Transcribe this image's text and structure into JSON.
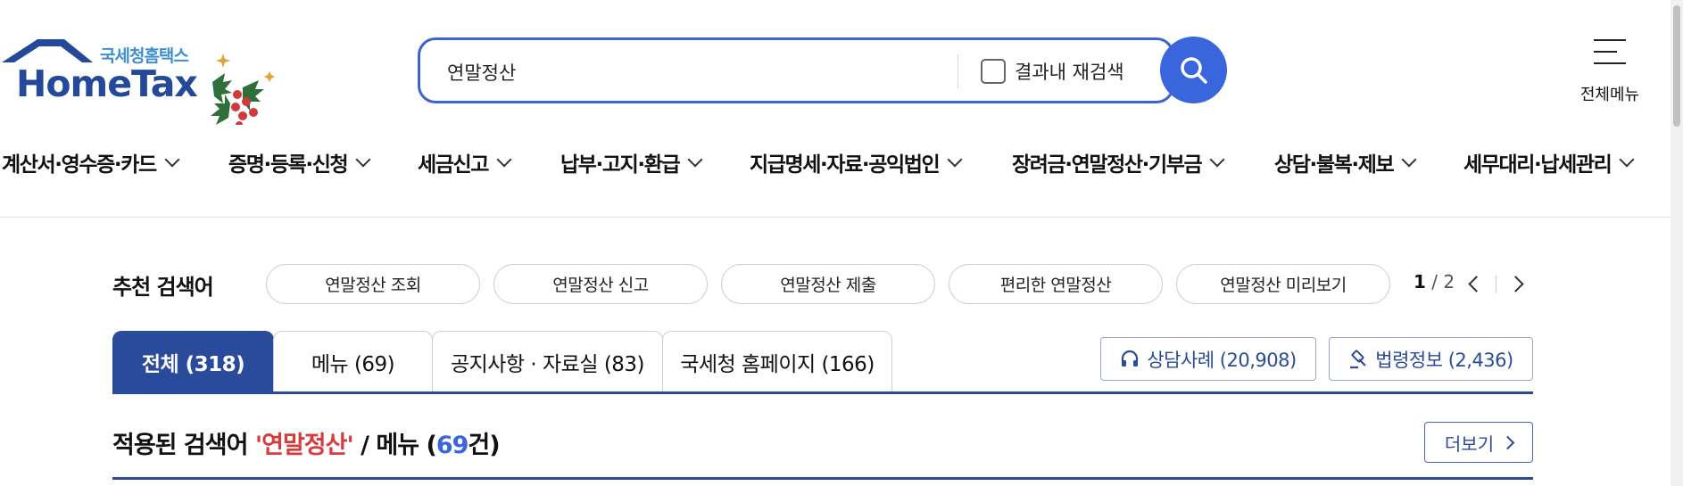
{
  "logo": {
    "small_text": "국세청홈택스",
    "big_text": "HomeTax"
  },
  "search": {
    "value": "연말정산",
    "research_label": "결과내 재검색"
  },
  "menu": {
    "label": "전체메뉴"
  },
  "gnb": [
    "계산서·영수증·카드",
    "증명·등록·신청",
    "세금신고",
    "납부·고지·환급",
    "지급명세·자료·공익법인",
    "장려금·연말정산·기부금",
    "상담·불복·제보",
    "세무대리·납세관리"
  ],
  "recommend": {
    "title": "추천 검색어",
    "chips": [
      "연말정산 조회",
      "연말정산 신고",
      "연말정산 제출",
      "편리한 연말정산",
      "연말정산 미리보기"
    ],
    "page_current": "1",
    "page_total": "2"
  },
  "tabs": [
    "전체 (318)",
    "메뉴 (69)",
    "공지사항 · 자료실 (83)",
    "국세청 홈페이지 (166)"
  ],
  "side_buttons": {
    "consult": "상담사례 (20,908)",
    "law": "법령정보 (2,436)"
  },
  "result": {
    "prefix": "적용된 검색어 ",
    "keyword": "'연말정산'",
    "middle": " / 메뉴 (",
    "count": "69",
    "suffix": "건)",
    "more_label": "더보기"
  },
  "colors": {
    "primary": "#2a4a9c",
    "search_border": "#3d63d2",
    "keyword": "#d83b3b",
    "count": "#3a66dd"
  }
}
